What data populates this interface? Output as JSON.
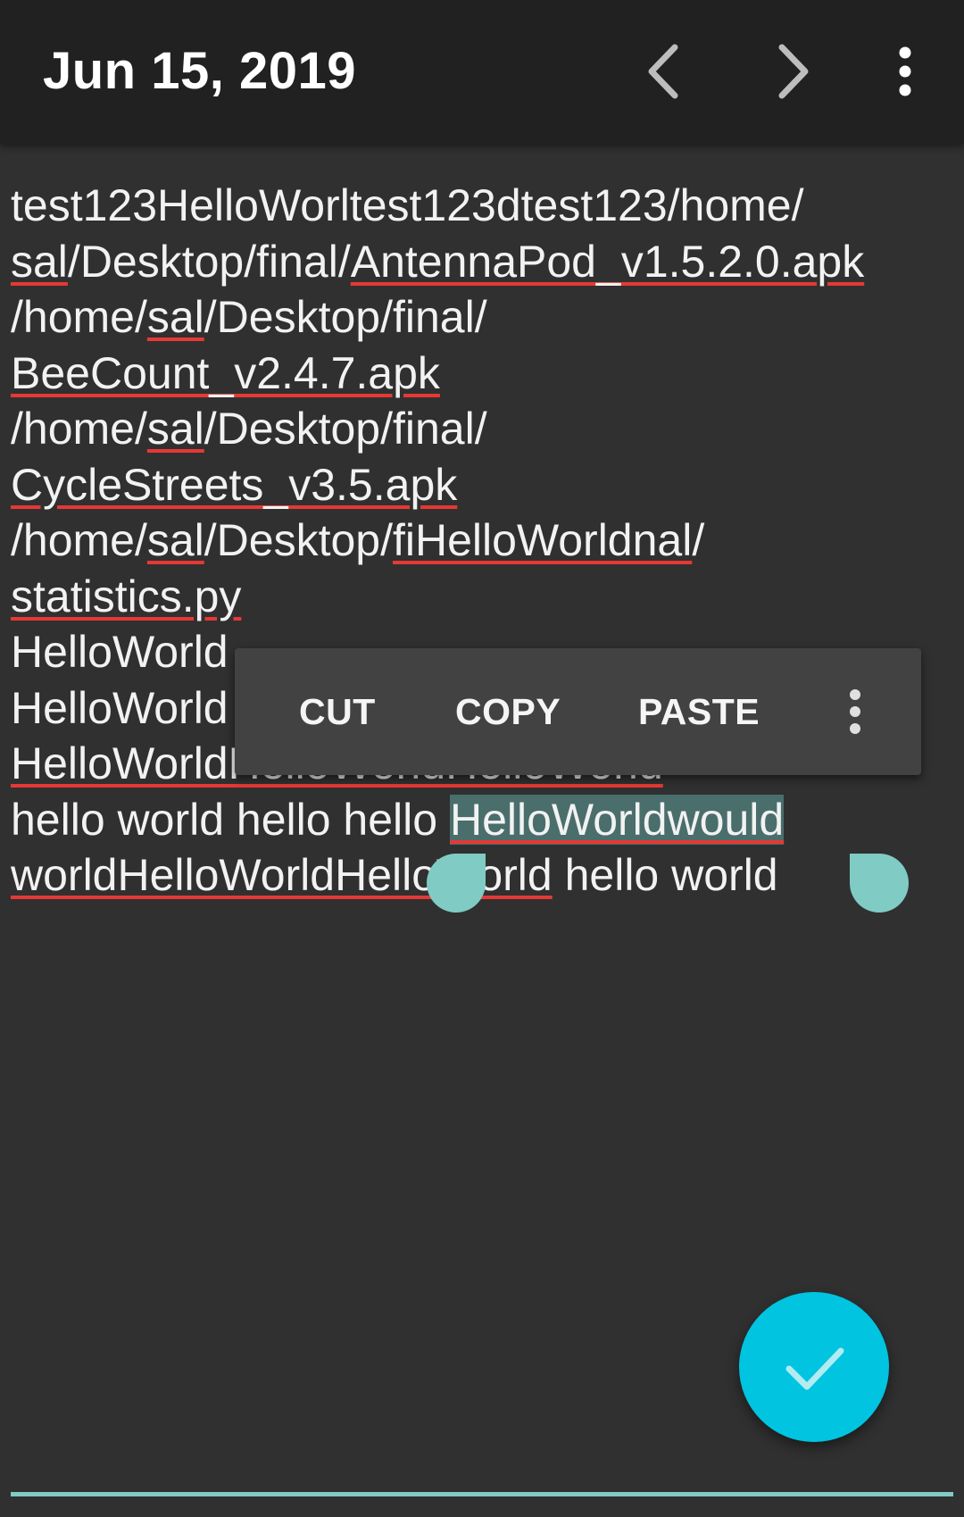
{
  "toolbar": {
    "title": "Jun 15, 2019",
    "prev_icon": "chevron-left-icon",
    "next_icon": "chevron-right-icon",
    "more_icon": "more-vertical-icon"
  },
  "editor": {
    "lines": [
      [
        {
          "t": "test123HelloWorltest123dtest123/home/"
        }
      ],
      [
        {
          "t": "sal",
          "sp": true
        },
        {
          "t": "/Desktop/final/"
        },
        {
          "t": "AntennaPod_",
          "sp": true
        },
        {
          "t": "v1.5.2.0.apk",
          "sp": true
        }
      ],
      [
        {
          "t": "/home/"
        },
        {
          "t": "sal",
          "sp": true
        },
        {
          "t": "/Desktop/final/"
        }
      ],
      [
        {
          "t": "BeeCount_",
          "sp": true
        },
        {
          "t": "v2.4.7.apk",
          "sp": true
        }
      ],
      [
        {
          "t": "/home/"
        },
        {
          "t": "sal",
          "sp": true
        },
        {
          "t": "/Desktop/final/"
        }
      ],
      [
        {
          "t": "CycleStreets_",
          "sp": true
        },
        {
          "t": "v3.5.apk",
          "sp": true
        }
      ],
      [
        {
          "t": "/home/"
        },
        {
          "t": "sal",
          "sp": true
        },
        {
          "t": "/Desktop/"
        },
        {
          "t": "fiHelloWorldnal",
          "sp": true
        },
        {
          "t": "/"
        }
      ],
      [
        {
          "t": "statistics.py",
          "sp": true
        }
      ],
      [
        {
          "t": "HelloWorld"
        }
      ],
      [
        {
          "t": "HelloWorld"
        }
      ],
      [
        {
          "t": "HelloWorldHelloWorldHelloWorld",
          "sp": true
        }
      ],
      [
        {
          "t": "hello world hello hello "
        },
        {
          "t": "HelloWorldwould",
          "sp": true,
          "sel": true
        }
      ],
      [
        {
          "t": "worldHelloWorldHelloWorld",
          "sp": true
        },
        {
          "t": " hello world"
        }
      ]
    ]
  },
  "context_menu": {
    "cut": "CUT",
    "copy": "COPY",
    "paste": "PASTE",
    "more_icon": "more-vertical-icon"
  },
  "fab": {
    "icon": "check-icon"
  },
  "colors": {
    "toolbar_bg": "#212121",
    "page_bg": "#303030",
    "accent": "#80cbc4",
    "fab": "#00c4e0",
    "spell_underline": "#e53935",
    "selection": "#4a6e6c",
    "menu_bg": "#424242"
  }
}
